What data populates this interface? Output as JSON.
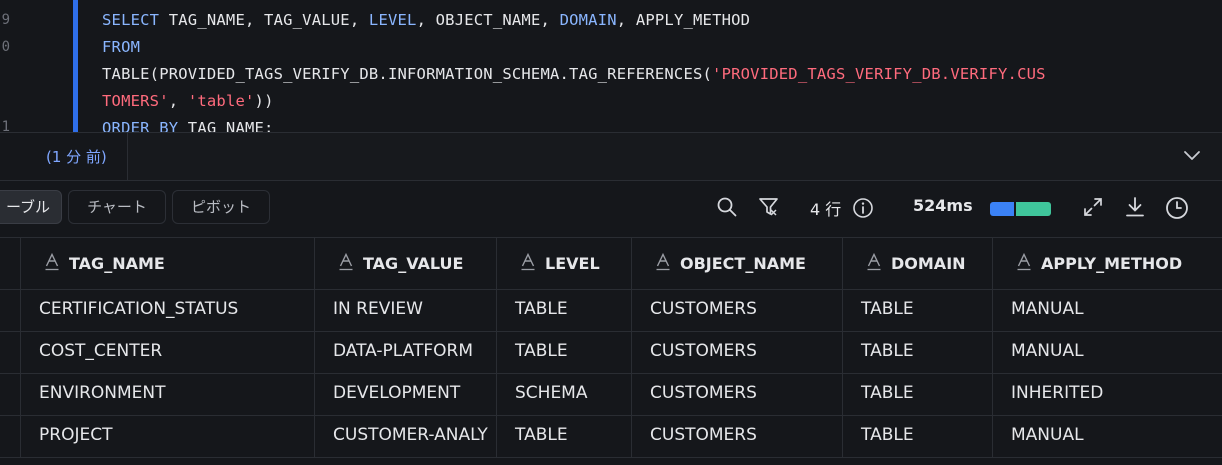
{
  "editor": {
    "gutter": [
      "9",
      "0",
      "1"
    ],
    "code": {
      "line1": {
        "kw1": "SELECT",
        "t1": " TAG_NAME, TAG_VALUE, ",
        "kw2": "LEVEL",
        "t2": ", OBJECT_NAME, ",
        "kw3": "DOMAIN",
        "t3": ", APPLY_METHOD"
      },
      "line2": {
        "kw": "FROM"
      },
      "line3": {
        "t1": "TABLE(PROVIDED_TAGS_VERIFY_DB.INFORMATION_SCHEMA.TAG_REFERENCES(",
        "s1": "'PROVIDED_TAGS_VERIFY_DB.VERIFY.CUS"
      },
      "line4": {
        "s1": "TOMERS'",
        "t1": ", ",
        "s2": "'table'",
        "t2": "))"
      },
      "line5": {
        "kw": "ORDER BY",
        "t1": " TAG_NAME;"
      }
    }
  },
  "results": {
    "tab_label": "(1 分 前)",
    "views": [
      "ーブル",
      "チャート",
      "ピボット"
    ],
    "row_count": "4 行",
    "timing": "524ms",
    "icons": [
      "search-icon",
      "filter-icon",
      "info-icon",
      "expand-icon",
      "download-icon",
      "history-icon",
      "chevron-down-icon"
    ]
  },
  "table": {
    "columns": [
      "TAG_NAME",
      "TAG_VALUE",
      "LEVEL",
      "OBJECT_NAME",
      "DOMAIN",
      "APPLY_METHOD"
    ],
    "rows": [
      [
        "CERTIFICATION_STATUS",
        "IN REVIEW",
        "TABLE",
        "CUSTOMERS",
        "TABLE",
        "MANUAL"
      ],
      [
        "COST_CENTER",
        "DATA-PLATFORM",
        "TABLE",
        "CUSTOMERS",
        "TABLE",
        "MANUAL"
      ],
      [
        "ENVIRONMENT",
        "DEVELOPMENT",
        "SCHEMA",
        "CUSTOMERS",
        "TABLE",
        "INHERITED"
      ],
      [
        "PROJECT",
        "CUSTOMER-ANALY",
        "TABLE",
        "CUSTOMERS",
        "TABLE",
        "MANUAL"
      ]
    ]
  },
  "colors": {
    "accent": "#2f6fea",
    "keyword": "#8ab6ff",
    "string": "#ff6b7d",
    "bar_blue": "#3b82f6",
    "bar_green": "#3fc59b"
  }
}
